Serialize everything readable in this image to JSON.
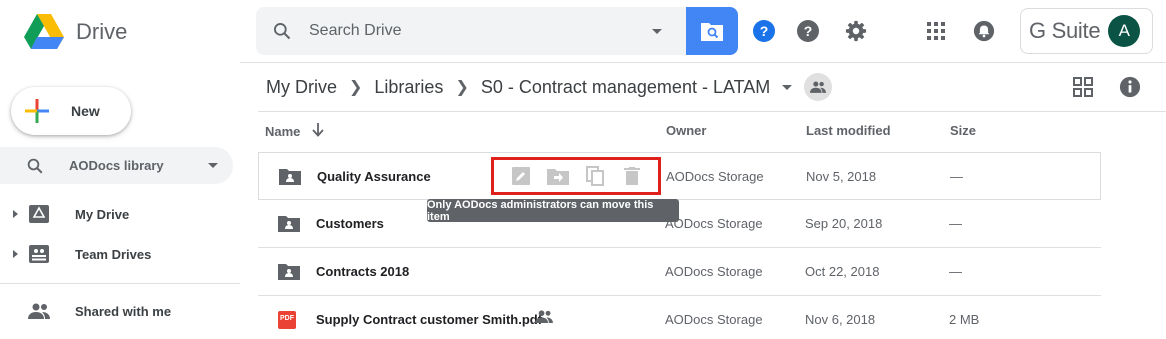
{
  "app": {
    "title": "Drive"
  },
  "search": {
    "placeholder": "Search Drive"
  },
  "topbar": {
    "icons": [
      "help-circle-blue-icon",
      "help-icon",
      "gear-icon",
      "apps-grid-icon",
      "notifications-bell-icon"
    ],
    "gsuite_label": "G Suite",
    "avatar_letter": "A"
  },
  "sidebar": {
    "new_label": "New",
    "library_select": "AODocs library",
    "items": [
      {
        "label": "My Drive",
        "icon": "drive-icon"
      },
      {
        "label": "Team Drives",
        "icon": "team-drives-icon"
      },
      {
        "label": "Shared with me",
        "icon": "people-icon"
      }
    ]
  },
  "breadcrumb": {
    "items": [
      "My Drive",
      "Libraries",
      "S0 - Contract management - LATAM"
    ]
  },
  "table": {
    "columns": {
      "name": "Name",
      "owner": "Owner",
      "modified": "Last modified",
      "size": "Size"
    },
    "rows": [
      {
        "name": "Quality Assurance",
        "owner": "AODocs Storage",
        "modified": "Nov 5, 2018",
        "size": "—",
        "type": "shared-folder"
      },
      {
        "name": "Customers",
        "owner": "AODocs Storage",
        "modified": "Sep 20, 2018",
        "size": "—",
        "type": "shared-folder"
      },
      {
        "name": "Contracts 2018",
        "owner": "AODocs Storage",
        "modified": "Oct 22, 2018",
        "size": "—",
        "type": "shared-folder"
      },
      {
        "name": "Supply Contract customer Smith.pdf",
        "owner": "AODocs Storage",
        "modified": "Nov 6, 2018",
        "size": "2 MB",
        "type": "pdf"
      }
    ]
  },
  "row_actions": [
    "edit-icon",
    "move-icon",
    "copy-icon",
    "trash-icon"
  ],
  "tooltip": "Only AODocs administrators can move this item",
  "pdf_badge": "PDF",
  "colors": {
    "accent": "#4285f4",
    "highlight": "#e0201b",
    "avatar": "#0b5345"
  }
}
